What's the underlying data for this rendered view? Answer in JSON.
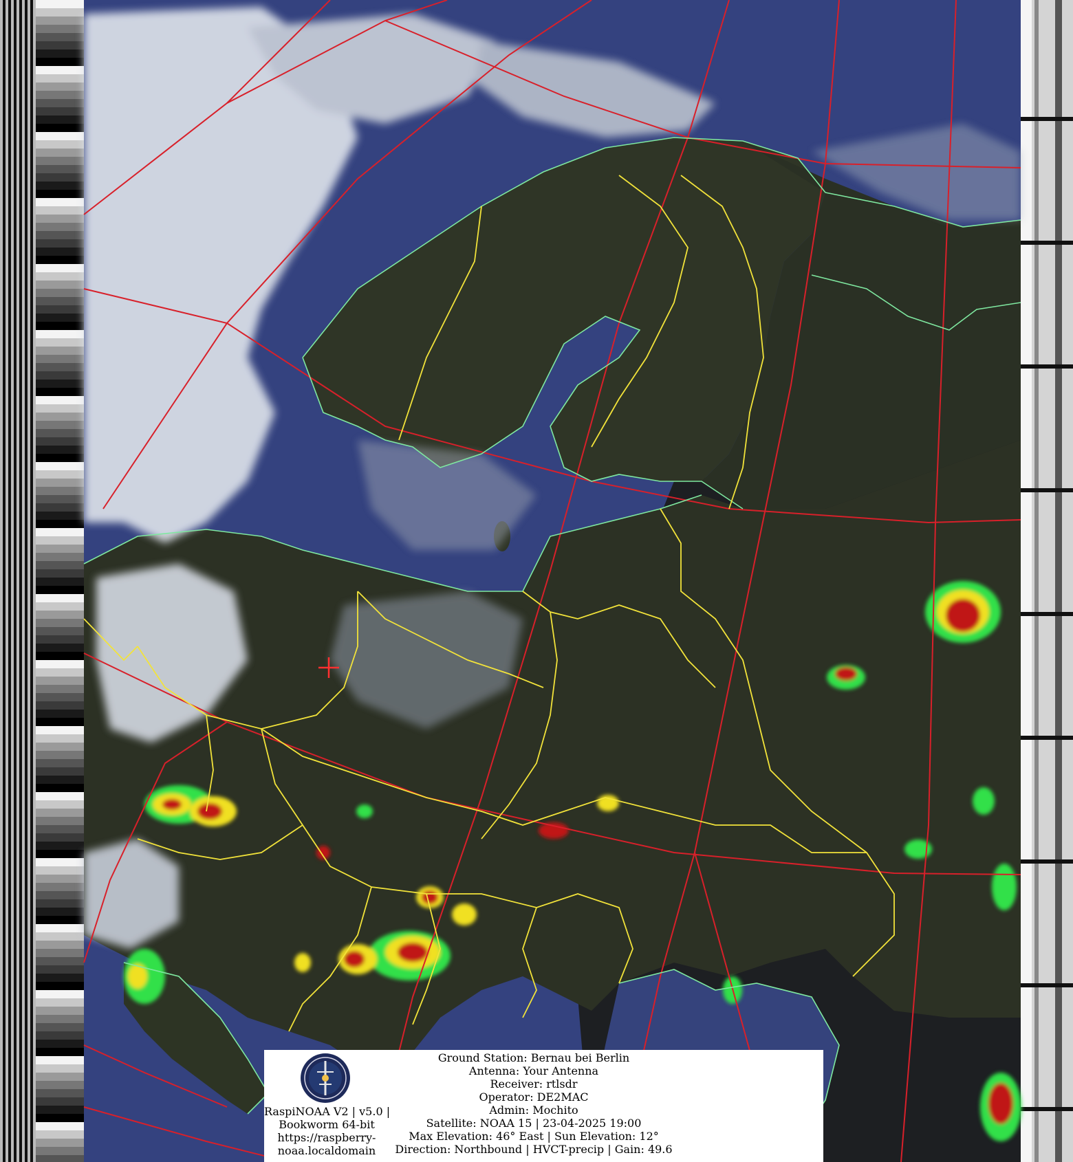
{
  "image": {
    "description_kind": "NOAA APT satellite image with map overlay",
    "colors": {
      "sea": "#3a4a8a",
      "land": "#2c3225",
      "cloud": "#d8dde6",
      "coastline": "#7fe8a0",
      "border": "#f2e33a",
      "graticule": "#d8202a",
      "precip_green": "#33e04a",
      "precip_yellow": "#f0e020",
      "precip_red": "#c01818"
    }
  },
  "overlay": {
    "app": {
      "line1": "RaspiNOAA V2 | v5.0 |",
      "line2": "Bookworm 64-bit",
      "line3": "https://raspberry-",
      "line4": "noaa.localdomain"
    },
    "station": {
      "ground_station": "Ground Station: Bernau bei Berlin",
      "antenna": "Antenna: Your Antenna",
      "receiver": "Receiver: rtlsdr",
      "operator": "Operator: DE2MAC",
      "admin": "Admin: Mochito",
      "satellite": "Satellite: NOAA 15 | 23-04-2025 19:00",
      "elevation": "Max Elevation: 46° East | Sun Elevation: 12°",
      "direction": "Direction: Northbound | HVCT-precip | Gain: 49.6"
    }
  }
}
